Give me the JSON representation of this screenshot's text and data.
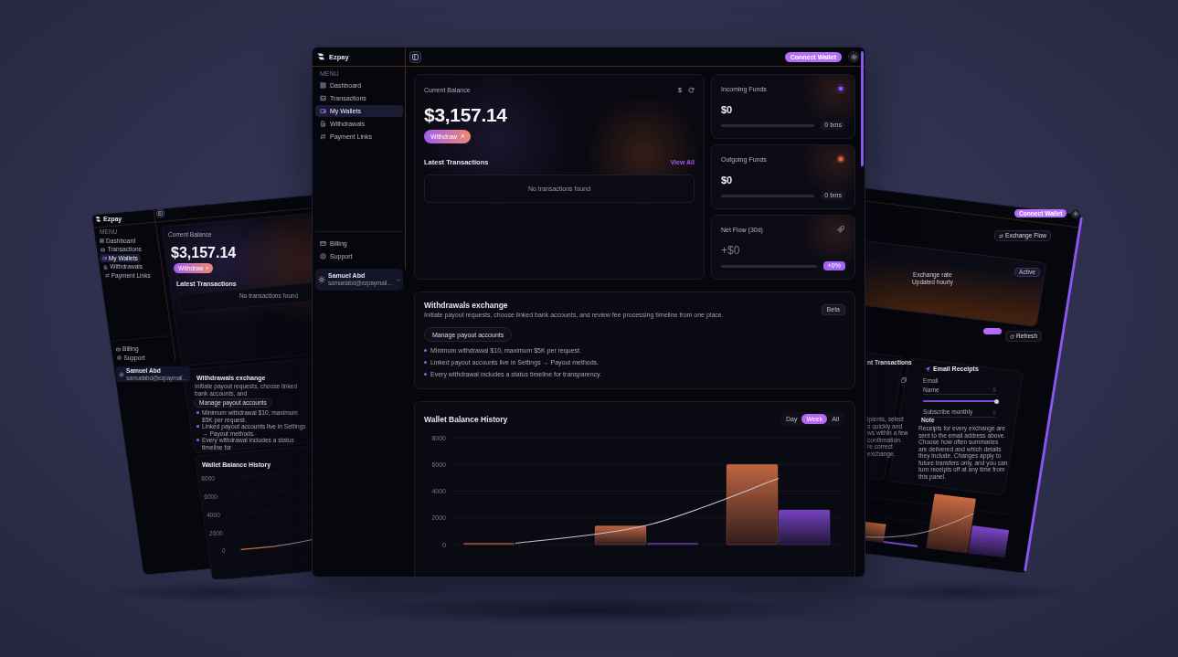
{
  "left_window": {
    "brand": "Ezpay",
    "sidebar": {
      "section_label": "MENU",
      "items": [
        {
          "label": "Dashboard",
          "selected": false
        },
        {
          "label": "Transactions",
          "selected": false
        },
        {
          "label": "My Wallets",
          "selected": true
        },
        {
          "label": "Withdrawals",
          "selected": false
        },
        {
          "label": "Payment Links",
          "selected": false
        }
      ],
      "footer_items": [
        {
          "label": "Billing"
        },
        {
          "label": "Support"
        }
      ],
      "user": {
        "name": "Samuel Abd",
        "email": "samuelabd@ezpaymail…"
      }
    },
    "balance_card": {
      "label": "Current Balance",
      "amount": "$3,157.14",
      "withdraw_button": "Withdraw",
      "transactions_title": "Latest Transactions",
      "empty_text": "No transactions found"
    },
    "withdrawals": {
      "title": "Withdrawals exchange",
      "description": "Initiate payout requests, choose linked bank accounts, and",
      "button": "Manage payout accounts",
      "bullets": [
        "Minimum withdrawal $10, maximum $5K per request.",
        "Linked payout accounts live in Settings → Payout methods.",
        "Every withdrawal includes a status timeline for"
      ]
    },
    "balance_history": {
      "title": "Wallet Balance History",
      "y_axis_labels": [
        "8000",
        "6000",
        "4000",
        "2000",
        "0"
      ]
    }
  },
  "main_window": {
    "brand": "Ezpay",
    "topbar": {
      "action_button": "Connect Wallet"
    },
    "sidebar": {
      "section_label": "MENU",
      "items": [
        {
          "label": "Dashboard",
          "selected": false
        },
        {
          "label": "Transactions",
          "selected": false
        },
        {
          "label": "My Wallets",
          "selected": true
        },
        {
          "label": "Withdrawals",
          "selected": false
        },
        {
          "label": "Payment Links",
          "selected": false
        }
      ],
      "footer_items": [
        {
          "label": "Billing"
        },
        {
          "label": "Support"
        }
      ],
      "user": {
        "name": "Samuel Abd",
        "email": "samuelabd@ezpaymail…"
      }
    },
    "balance_card": {
      "label": "Current Balance",
      "currency_button": "$",
      "amount": "$3,157.14",
      "withdraw_button": "Withdraw",
      "transactions_title": "Latest Transactions",
      "view_all": "View All",
      "empty_text": "No transactions found"
    },
    "stat_cards": [
      {
        "kind": "incoming",
        "title": "Incoming Funds",
        "value": "$0",
        "level": 0,
        "badge": "0 txns"
      },
      {
        "kind": "outgoing",
        "title": "Outgoing Funds",
        "value": "$0",
        "level": 0,
        "badge": "0 txns"
      },
      {
        "kind": "net",
        "title": "Net Flow (30d)",
        "value": "+$0",
        "level": 0,
        "badge": "+0%"
      }
    ],
    "withdrawals": {
      "title": "Withdrawals exchange",
      "badge": "Beta",
      "description": "Initiate payout requests, choose linked bank accounts, and review fee processing timeline from one place.",
      "button": "Manage payout accounts",
      "bullets": [
        "Minimum withdrawal $10, maximum $5K per request.",
        "Linked payout accounts live in Settings → Payout methods.",
        "Every withdrawal includes a status timeline for transparency."
      ]
    },
    "balance_history": {
      "title": "Wallet Balance History",
      "ranges": [
        {
          "label": "Day",
          "selected": false
        },
        {
          "label": "Week",
          "selected": true
        },
        {
          "label": "All",
          "selected": false
        }
      ],
      "chart_data": {
        "type": "bar",
        "stacked": false,
        "grid": true,
        "ylim": [
          0,
          8000
        ],
        "yticks": [
          0,
          2000,
          4000,
          6000,
          8000
        ],
        "series": [
          {
            "type": "bar",
            "color": "#c96a42",
            "values": [
              100,
              1400,
              6000
            ]
          },
          {
            "type": "bar",
            "color": "#7b45c9",
            "values": [
              0,
              100,
              2600
            ]
          },
          {
            "type": "line",
            "color": "#c4c4d4",
            "values": [
              100,
              1450,
              4950
            ]
          }
        ]
      }
    }
  },
  "right_window": {
    "action_button": "Connect Wallet",
    "exchange_button": "Exchange Flow",
    "rate_card": {
      "badge": "Active",
      "lines": [
        "Exchange rate",
        "Updated hourly"
      ]
    },
    "toggle": {
      "on": true
    },
    "refresh_button": "Refresh",
    "transactions_card": {
      "title": "nt Transactions",
      "text_lines": [
        "ipients, select",
        "s quickly and",
        "ws within a few",
        "confirmation.",
        "re correct",
        "exchange."
      ]
    },
    "receipts_card": {
      "title": "Email Receipts",
      "rows": [
        {
          "kind": "label",
          "text": "Email"
        },
        {
          "kind": "select",
          "text": "Name"
        },
        {
          "kind": "slider",
          "level": 1
        },
        {
          "kind": "select",
          "text": "Subscribe monthly"
        }
      ],
      "note_title": "Note",
      "note": "Receipts for every exchange are sent to the email address above. Choose how often summaries are delivered and which details they include. Changes apply to future transfers only, and you can turn receipts off at any time from this panel."
    }
  }
}
